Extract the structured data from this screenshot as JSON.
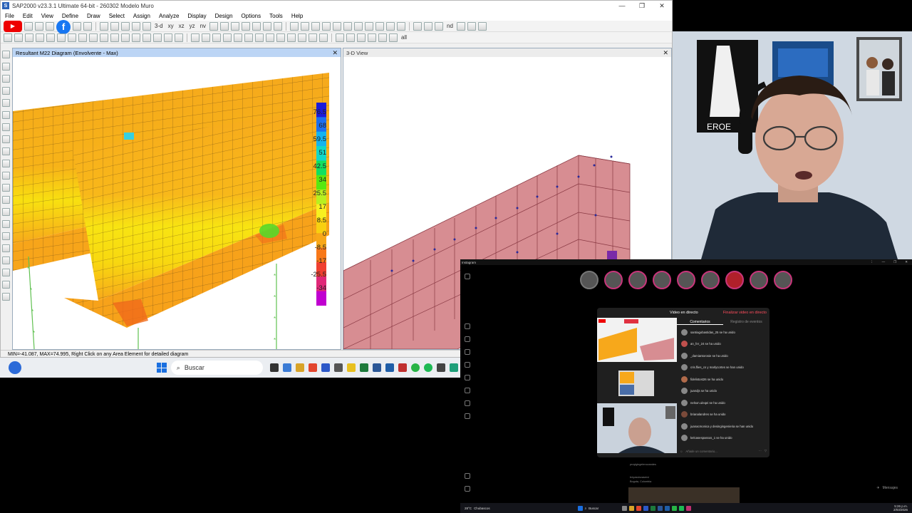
{
  "sap": {
    "title": "SAP2000 v23.3.1 Ultimate 64-bit - 260302 Modelo Muro",
    "app_icon": "S",
    "menu": [
      "File",
      "Edit",
      "View",
      "Define",
      "Draw",
      "Select",
      "Assign",
      "Analyze",
      "Display",
      "Design",
      "Options",
      "Tools",
      "Help"
    ],
    "toolbar_text": [
      "3-d",
      "xy",
      "xz",
      "yz",
      "nv",
      "nd",
      "all"
    ],
    "pane1_title": "Resultant M22 Diagram  (Envolvente - Max)",
    "pane2_title": "3-D View",
    "legend_values": [
      "76.5",
      "68",
      "59.5",
      "51",
      "42.5",
      "34",
      "25.5",
      "17",
      "8.5",
      "0",
      "-8.5",
      "-17",
      "-25.5",
      "-34"
    ],
    "legend_colors": [
      "#1b1bd8",
      "#1a6ff0",
      "#14b4f0",
      "#11d8c8",
      "#10e060",
      "#58e810",
      "#b8f020",
      "#f8f020",
      "#f8d010",
      "#f8a818",
      "#f87818",
      "#f04030",
      "#e02878",
      "#c000d0"
    ],
    "status": "MIN=-41.087, MAX=74.995, Right Click on any Area Element for detailed diagram",
    "plate_color": "#f7a81b",
    "mesh_color": "#c96d74"
  },
  "taskbar": {
    "search_placeholder": "Buscar"
  },
  "instagram": {
    "window_title": "Instagram",
    "modal_title": "Video en directo",
    "end_button": "Finalizar video en directo",
    "tabs": [
      "Comentarios",
      "Registro de eventos"
    ],
    "comments": [
      "santiagobastidas_25 se ha unido",
      "an_fer_24 se ha unido",
      "_damiantorosie se ha unido",
      "cris.flies_cs y marlycortes se han unido",
      "fidelistost26 se ha unido",
      "juandjs se ha unido",
      "nelson.uleqei se ha unido",
      "brianalandres se ha unido",
      "juanacmonica y desingingenieria se han unido",
      "kelcasespassos_1 se ha unido"
    ],
    "comment_placeholder": "Añade un comentario...",
    "messages_label": "Mensajes",
    "feed_user": "proyigingelenovandes",
    "feed_user2": "treyasvisvaservi",
    "feed_location": "Bogota, Colombia",
    "taskbar_search": "Buscar",
    "weather": "28°C",
    "weather_sub": "Chubascos",
    "clock": "5:26 p.m.",
    "date": "2/03/2026"
  }
}
